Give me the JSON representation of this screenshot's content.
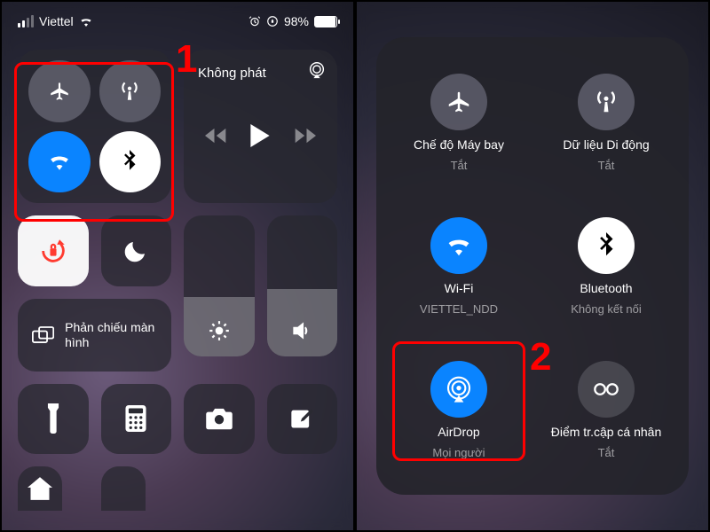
{
  "status": {
    "carrier": "Viettel",
    "battery_pct": "98%"
  },
  "left": {
    "media_title": "Không phát",
    "screen_mirror": "Phản chiếu màn hình"
  },
  "expanded": {
    "airplane": {
      "label": "Chế độ Máy bay",
      "status": "Tắt"
    },
    "cellular": {
      "label": "Dữ liệu Di động",
      "status": "Tắt"
    },
    "wifi": {
      "label": "Wi-Fi",
      "status": "VIETTEL_NDD"
    },
    "bluetooth": {
      "label": "Bluetooth",
      "status": "Không kết nối"
    },
    "airdrop": {
      "label": "AirDrop",
      "status": "Mọi người"
    },
    "hotspot": {
      "label": "Điểm tr.cập cá nhân",
      "status": "Tắt"
    }
  },
  "annotations": {
    "one": "1",
    "two": "2"
  }
}
